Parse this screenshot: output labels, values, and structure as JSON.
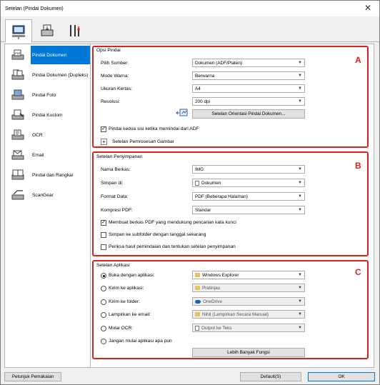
{
  "window": {
    "title": "Setelan (Pindai Dokumen)"
  },
  "sidebar": {
    "items": [
      {
        "label": "Pindai Dokumen",
        "icon": "document-scan-icon"
      },
      {
        "label": "Pindai Dokumen (Dupleks)",
        "icon": "duplex-scan-icon"
      },
      {
        "label": "Pindai Foto",
        "icon": "photo-scan-icon"
      },
      {
        "label": "Pindai Kustom",
        "icon": "custom-scan-icon"
      },
      {
        "label": "OCR",
        "icon": "ocr-icon"
      },
      {
        "label": "Email",
        "icon": "email-icon"
      },
      {
        "label": "Pindai dan Rangkai",
        "icon": "stitch-icon"
      },
      {
        "label": "ScanGear",
        "icon": "scangear-icon"
      }
    ]
  },
  "scan_options": {
    "title": "Opsi Pindai",
    "letter": "A",
    "source_label": "Pilih Sumber:",
    "source_value": "Dokumen (ADF/Platen)",
    "color_label": "Mode Warna:",
    "color_value": "Berwarna",
    "paper_label": "Ukuran Kertas:",
    "paper_value": "A4",
    "res_label": "Resolusi:",
    "res_value": "200 dpi",
    "orient_button": "Setelan Orientasi Pindai Dokumen...",
    "both_sides": "Pindai kedua sisi ketika memindai dari ADF",
    "image_proc": "Setelan Pemrosesan Gambar"
  },
  "save_settings": {
    "title": "Setelan Penyimpanan",
    "letter": "B",
    "filename_label": "Nama Berkas:",
    "filename_value": "IMG",
    "savein_label": "Simpan di:",
    "savein_value": "Dokumen",
    "format_label": "Format Data:",
    "format_value": "PDF (Beberapa Halaman)",
    "compress_label": "Kompresi PDF:",
    "compress_value": "Standar",
    "keyword_pdf": "Membuat berkas PDF yang mendukung pencarian kata kunci",
    "subfolder": "Simpan ke subfolder dengan tanggal sekarang",
    "check_results": "Periksa hasil pemindaian dan tentukan setelan penyimpanan"
  },
  "app_settings": {
    "title": "Setelan Aplikasi",
    "letter": "C",
    "open_app_label": "Buka dengan aplikasi:",
    "open_app_value": "Windows Explorer",
    "send_app_label": "Kirim ke aplikasi:",
    "send_app_value": "Pratinjau",
    "send_folder_label": "Kirim ke folder:",
    "send_folder_value": "OneDrive",
    "email_label": "Lampirkan ke email:",
    "email_value": "Nihil (Lampirkan Secara Manual)",
    "ocr_label": "Mulai OCR:",
    "ocr_value": "Output ke Teks",
    "none_label": "Jangan mulai aplikasi apa pun",
    "more_button": "Lebih Banyak Fungsi"
  },
  "footer": {
    "help": "Petunjuk Pemakaian",
    "defaults": "Default(S)",
    "ok": "OK"
  }
}
